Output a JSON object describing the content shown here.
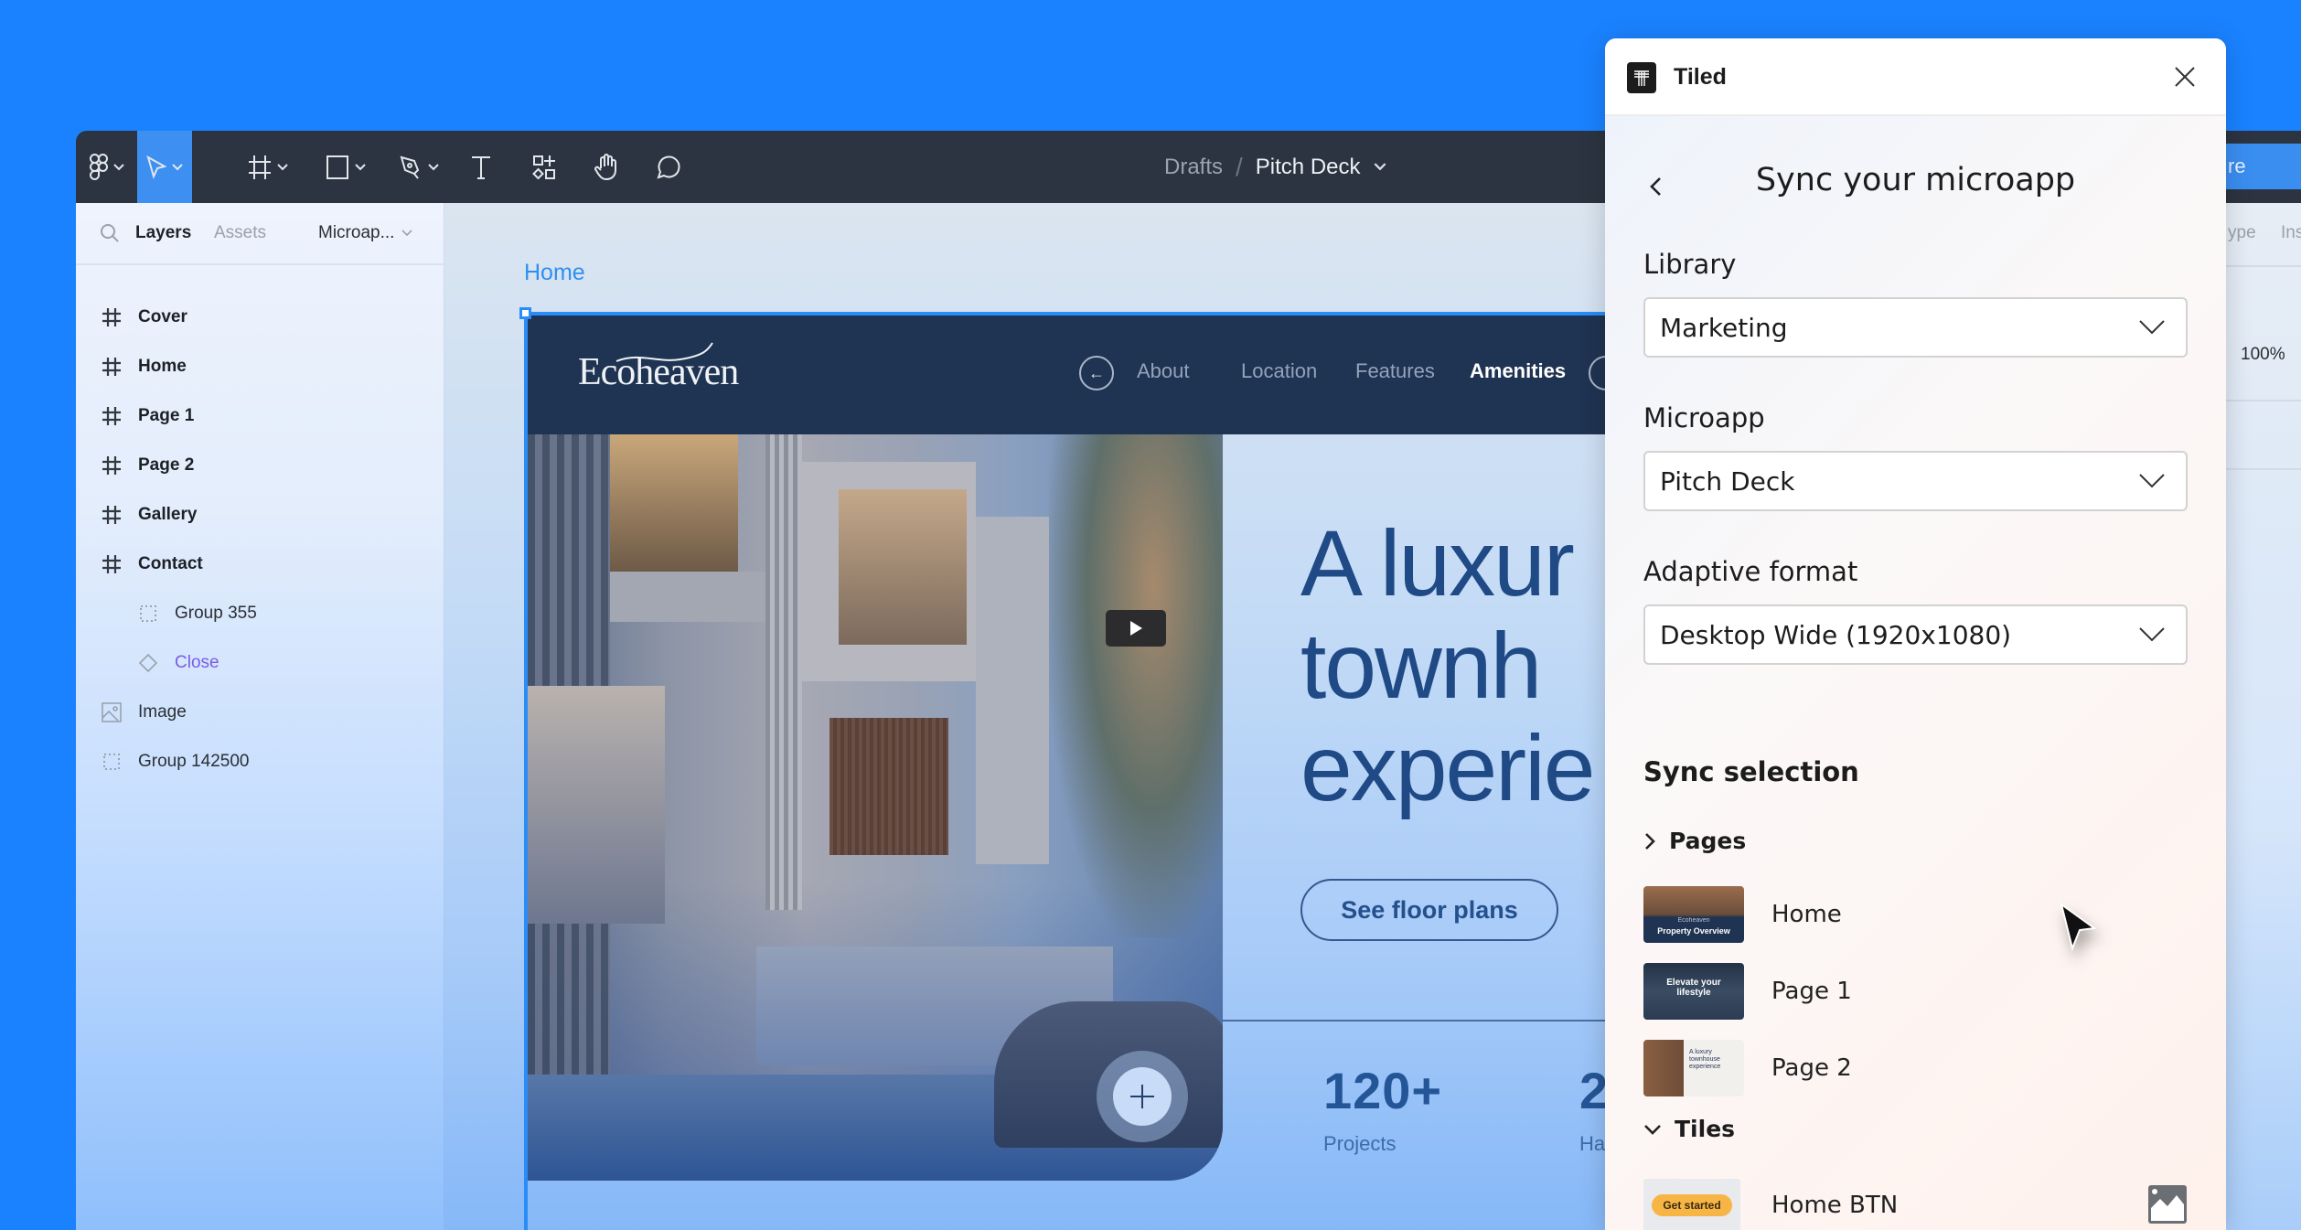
{
  "app": {
    "background_color": "#1a82ff",
    "accent_color": "#3d8ff2"
  },
  "toolbar": {
    "tools": [
      {
        "name": "main-menu",
        "icon": "figma-logo-icon",
        "has_dropdown": true
      },
      {
        "name": "move",
        "icon": "cursor-arrow-icon",
        "has_dropdown": true,
        "active": true
      },
      {
        "name": "frame",
        "icon": "frame-hash-icon",
        "has_dropdown": true
      },
      {
        "name": "shape",
        "icon": "rectangle-icon",
        "has_dropdown": true
      },
      {
        "name": "pen",
        "icon": "pen-icon",
        "has_dropdown": true
      },
      {
        "name": "text",
        "icon": "text-icon",
        "has_dropdown": false
      },
      {
        "name": "resources",
        "icon": "components-icon",
        "has_dropdown": false
      },
      {
        "name": "hand",
        "icon": "hand-icon",
        "has_dropdown": false
      },
      {
        "name": "comment",
        "icon": "comment-icon",
        "has_dropdown": false
      }
    ],
    "breadcrumb": {
      "folder": "Drafts",
      "separator": "/",
      "file": "Pitch Deck"
    },
    "share_label_visible": "re"
  },
  "left_panel": {
    "tabs": [
      "Layers",
      "Assets"
    ],
    "active_tab": "Layers",
    "page_select": "Microap...",
    "layers": [
      {
        "name": "Cover",
        "type": "frame"
      },
      {
        "name": "Home",
        "type": "frame"
      },
      {
        "name": "Page 1",
        "type": "frame"
      },
      {
        "name": "Page 2",
        "type": "frame"
      },
      {
        "name": "Gallery",
        "type": "frame"
      },
      {
        "name": "Contact",
        "type": "frame"
      },
      {
        "name": "Group 355",
        "type": "group",
        "indent": 1
      },
      {
        "name": "Close",
        "type": "component",
        "indent": 1
      },
      {
        "name": "Image",
        "type": "image"
      },
      {
        "name": "Group 142500",
        "type": "group"
      }
    ]
  },
  "canvas": {
    "frame_label": "Home",
    "site": {
      "logo": "Ecoheaven",
      "nav": [
        "About",
        "Location",
        "Features",
        "Amenities"
      ],
      "nav_active": "Amenities",
      "hero_title_lines": [
        "A luxur",
        "townh",
        "experie"
      ],
      "cta": "See floor plans",
      "stats": [
        {
          "value": "120+",
          "label": "Projects"
        },
        {
          "value": "2",
          "label": "Ha"
        }
      ]
    }
  },
  "inspector": {
    "tabs_visible": [
      "ype",
      "Ins"
    ],
    "zoom": "100%"
  },
  "plugin": {
    "name": "Tiled",
    "title": "Sync your microapp",
    "fields": [
      {
        "label": "Library",
        "value": "Marketing"
      },
      {
        "label": "Microapp",
        "value": "Pitch Deck"
      },
      {
        "label": "Adaptive format",
        "value": "Desktop Wide (1920x1080)"
      }
    ],
    "sync_heading": "Sync selection",
    "pages_group": {
      "label": "Pages",
      "expanded": false,
      "items": [
        {
          "label": "Home",
          "thumb_text": "Property Overview",
          "thumb_sub": "Ecoheaven"
        },
        {
          "label": "Page 1",
          "thumb_text": "Elevate your lifestyle"
        },
        {
          "label": "Page 2",
          "thumb_text": "A luxury townhouse experience"
        }
      ]
    },
    "tiles_group": {
      "label": "Tiles",
      "expanded": true,
      "items": [
        {
          "label": "Home BTN",
          "thumb_text": "Get started",
          "type_icon": "image-icon"
        }
      ]
    }
  }
}
